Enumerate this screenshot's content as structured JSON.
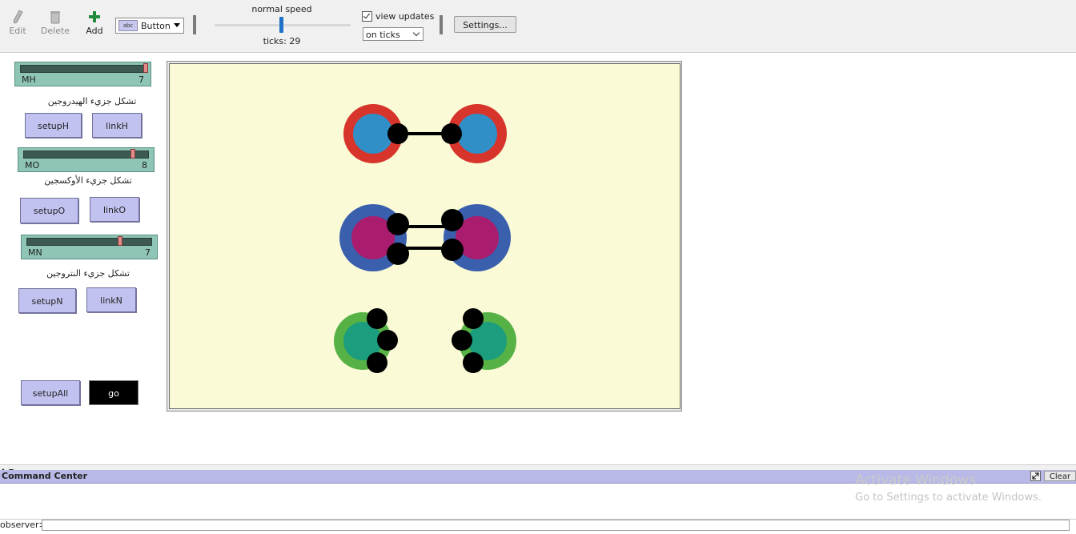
{
  "toolbar": {
    "edit_label": "Edit",
    "delete_label": "Delete",
    "add_label": "Add",
    "widget_type": "Button",
    "widget_icon_text": "abc",
    "speed_label": "normal speed",
    "speed_value": 0.5,
    "ticks_label": "ticks:",
    "ticks_value": "29",
    "view_updates_label": "view updates",
    "view_updates_checked": true,
    "update_mode": "on ticks",
    "settings_label": "Settings..."
  },
  "interface": {
    "slider_mh": {
      "name": "MH",
      "value": "7"
    },
    "note_h": "تشكل جزيء الهيدروجين",
    "btn_setupH": "setupH",
    "btn_linkH": "linkH",
    "slider_mo": {
      "name": "MO",
      "value": "8"
    },
    "note_o": "تشكل جزيء الأوكسجين",
    "btn_setupO": "setupO",
    "btn_linkO": "linkO",
    "slider_mn": {
      "name": "MN",
      "value": "7"
    },
    "note_n": "تشكل جزيء النتروجين",
    "btn_setupN": "setupN",
    "btn_linkN": "linkN",
    "btn_setupAll": "setupAll",
    "btn_go": "go"
  },
  "world": {
    "background": "#fafad6",
    "colors": {
      "h_outer": "#d7342b",
      "h_inner": "#2f8fc6",
      "o_outer": "#3a5fad",
      "o_inner": "#aa1d6e",
      "n_outer": "#57b245",
      "n_inner": "#1b9d7e",
      "electron": "#000000"
    }
  },
  "command_center": {
    "title": "Command Center",
    "clear_label": "Clear",
    "prompt": "observer>"
  },
  "watermark": {
    "line1": "Activate Windows",
    "line2": "Go to Settings to activate Windows."
  }
}
